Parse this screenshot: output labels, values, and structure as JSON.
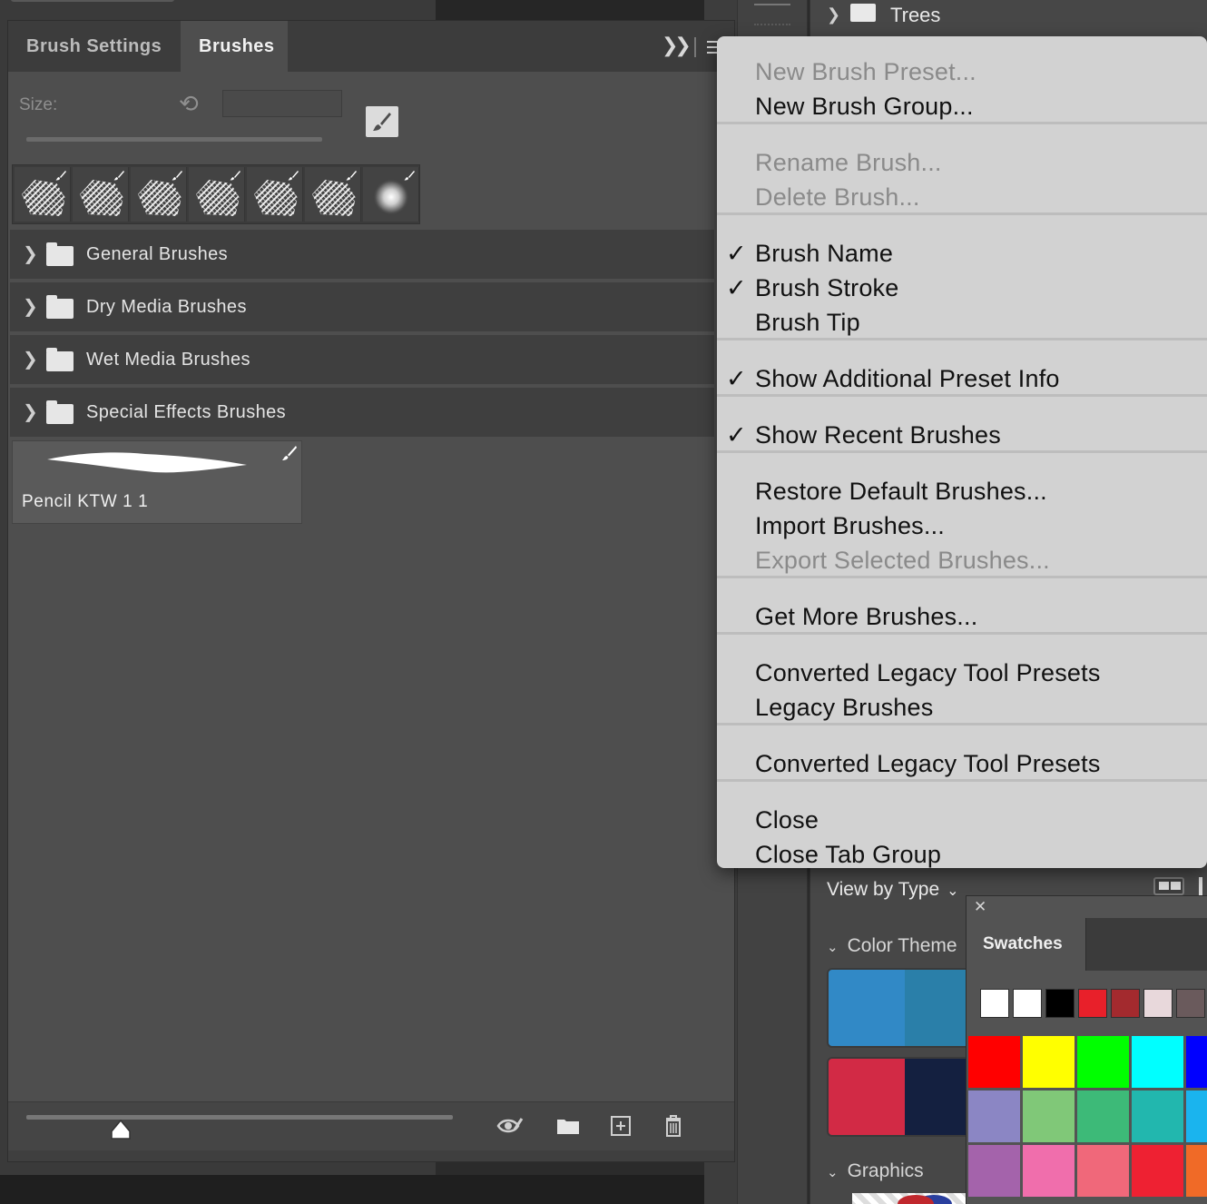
{
  "background_panels": {
    "trees_label": "Trees",
    "view_by_label": "View by Type",
    "color_themes_label": "Color Theme",
    "graphics_label": "Graphics",
    "theme_cards": [
      [
        "#3189c6",
        "#2a7fa9"
      ],
      [
        "#d22a45",
        "#142040"
      ]
    ]
  },
  "brushes_panel": {
    "tabs": [
      {
        "label": "Brush Settings",
        "active": false
      },
      {
        "label": "Brushes",
        "active": true
      }
    ],
    "size_label": "Size:",
    "size_value": "",
    "recent_brushes": [
      {
        "kind": "texture"
      },
      {
        "kind": "texture"
      },
      {
        "kind": "texture"
      },
      {
        "kind": "texture"
      },
      {
        "kind": "texture"
      },
      {
        "kind": "texture"
      },
      {
        "kind": "soft-round"
      }
    ],
    "groups": [
      {
        "label": "General Brushes"
      },
      {
        "label": "Dry Media Brushes"
      },
      {
        "label": "Wet Media Brushes"
      },
      {
        "label": "Special Effects Brushes"
      }
    ],
    "selected_brush": {
      "name": "Pencil KTW 1 1"
    }
  },
  "flyout_menu": {
    "items": [
      {
        "label": "New Brush Preset...",
        "enabled": false,
        "checked": false
      },
      {
        "label": "New Brush Group...",
        "enabled": true,
        "checked": false
      },
      {
        "label": "Rename Brush...",
        "enabled": false,
        "checked": false
      },
      {
        "label": "Delete Brush...",
        "enabled": false,
        "checked": false
      },
      {
        "label": "Brush Name",
        "enabled": true,
        "checked": true
      },
      {
        "label": "Brush Stroke",
        "enabled": true,
        "checked": true
      },
      {
        "label": "Brush Tip",
        "enabled": true,
        "checked": false
      },
      {
        "label": "Show Additional Preset Info",
        "enabled": true,
        "checked": true
      },
      {
        "label": "Show Recent Brushes",
        "enabled": true,
        "checked": true
      },
      {
        "label": "Restore Default Brushes...",
        "enabled": true,
        "checked": false
      },
      {
        "label": "Import Brushes...",
        "enabled": true,
        "checked": false
      },
      {
        "label": "Export Selected Brushes...",
        "enabled": false,
        "checked": false
      },
      {
        "label": "Get More Brushes...",
        "enabled": true,
        "checked": false
      },
      {
        "label": "Converted Legacy Tool Presets",
        "enabled": true,
        "checked": false
      },
      {
        "label": "Legacy Brushes",
        "enabled": true,
        "checked": false
      },
      {
        "label": "Converted Legacy Tool Presets",
        "enabled": true,
        "checked": false
      },
      {
        "label": "Close",
        "enabled": true,
        "checked": false
      },
      {
        "label": "Close Tab Group",
        "enabled": true,
        "checked": false
      }
    ]
  },
  "swatches_panel": {
    "tab_label": "Swatches",
    "recent_colors": [
      "#ffffff",
      "#ffffff",
      "#000000",
      "#e8202a",
      "#a32a2e",
      "#e8d8db",
      "#6a5a5c"
    ],
    "grid": [
      [
        "#ff0000",
        "#ffff00",
        "#00ff00",
        "#00ffff",
        "#0000ff"
      ],
      [
        "#8b86c4",
        "#80c878",
        "#3dba78",
        "#22b7ae",
        "#1ab4ee"
      ],
      [
        "#a463ab",
        "#f06eac",
        "#f0687a",
        "#ee2132",
        "#f06a27"
      ]
    ]
  }
}
